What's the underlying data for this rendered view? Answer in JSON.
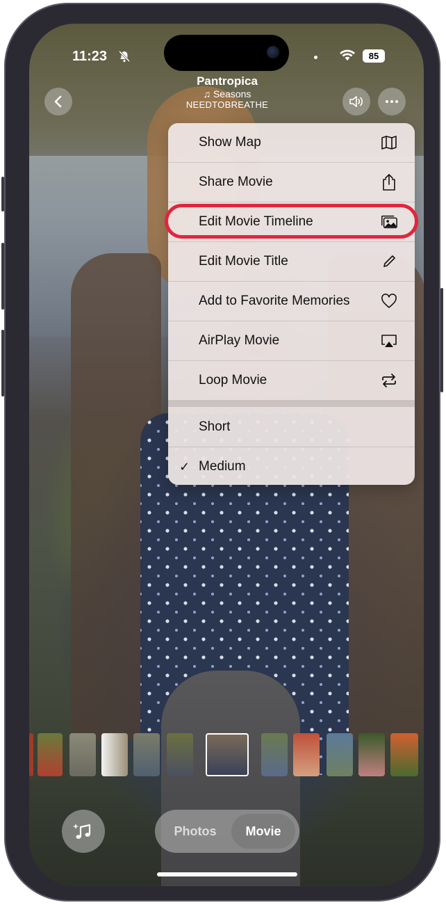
{
  "status_bar": {
    "time": "11:23",
    "battery": "85"
  },
  "now_playing": {
    "title": "Pantropica",
    "song": "♫ Seasons",
    "artist": "NEEDTOBREATHE"
  },
  "menu": {
    "items": [
      {
        "label": "Show Map",
        "icon": "map-icon"
      },
      {
        "label": "Share Movie",
        "icon": "share-icon"
      },
      {
        "label": "Edit Movie Timeline",
        "icon": "photo-stack-icon",
        "highlighted": true
      },
      {
        "label": "Edit Movie Title",
        "icon": "pencil-icon"
      },
      {
        "label": "Add to Favorite Memories",
        "icon": "heart-icon"
      },
      {
        "label": "AirPlay Movie",
        "icon": "airplay-icon"
      },
      {
        "label": "Loop Movie",
        "icon": "loop-icon"
      }
    ],
    "durations": [
      {
        "label": "Short",
        "checked": false
      },
      {
        "label": "Medium",
        "checked": true
      }
    ]
  },
  "segmented": {
    "photos_label": "Photos",
    "movie_label": "Movie",
    "selected": "Movie"
  },
  "colors": {
    "highlight": "#e0263d"
  }
}
